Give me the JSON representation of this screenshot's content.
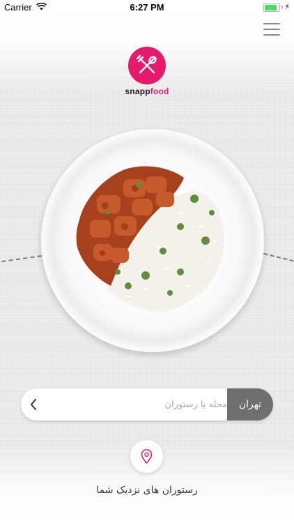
{
  "status_bar": {
    "carrier": "Carrier",
    "time": "6:27 PM",
    "battery_level": 0.95
  },
  "menu": {
    "icon": "hamburger-menu-icon"
  },
  "brand": {
    "name_part1": "snapp",
    "name_part2": "food",
    "logo_icon": "fork-knife-icon",
    "accent_color": "#e6196d"
  },
  "hero": {
    "image": "plate-of-stew-and-rice"
  },
  "search": {
    "city_label": "تهران",
    "placeholder": "نام محله یا رستوران",
    "value": "",
    "submit_icon": "chevron-left-icon"
  },
  "nearby": {
    "icon": "map-pin-icon",
    "label": "رستوران های نزدیک شما"
  }
}
